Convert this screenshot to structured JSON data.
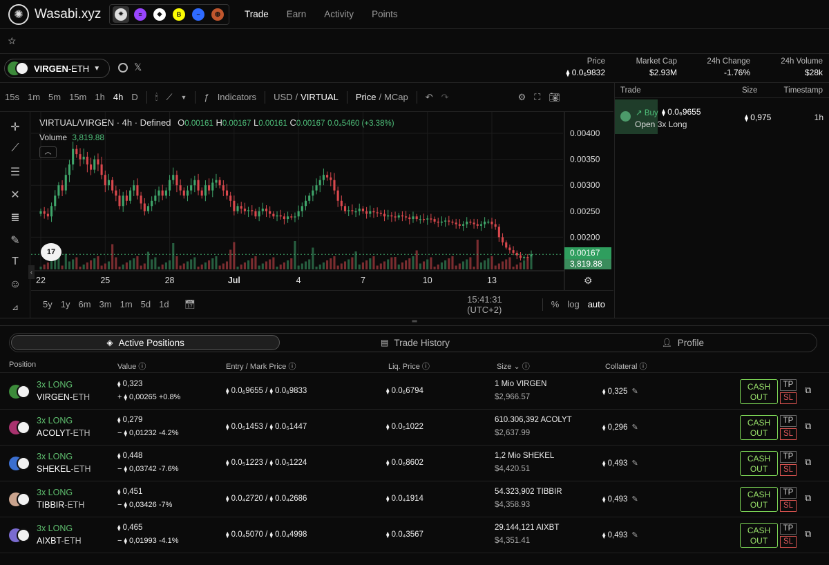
{
  "app": {
    "name": "Wasabi.xyz"
  },
  "nav": [
    "Trade",
    "Earn",
    "Activity",
    "Points"
  ],
  "chains": [
    {
      "icon": "wasabi-icon",
      "color": "#dddddd",
      "glyph": "✷"
    },
    {
      "icon": "solana-icon",
      "color": "#9945ff",
      "glyph": "≡"
    },
    {
      "icon": "ethereum-icon",
      "color": "#ffffff",
      "glyph": "◆"
    },
    {
      "icon": "blast-icon",
      "color": "#fcfc03",
      "glyph": "B"
    },
    {
      "icon": "base-icon",
      "color": "#2f6bff",
      "glyph": "−"
    },
    {
      "icon": "ape-icon",
      "color": "#c0562d",
      "glyph": "◍"
    }
  ],
  "favorites": {
    "star": "☆"
  },
  "pair": {
    "base": "VIRGEN",
    "quote": "-ETH"
  },
  "stats": {
    "price_label": "Price",
    "price_value": "0.0₆9832",
    "mcap_label": "Market Cap",
    "mcap_value": "$2.93M",
    "change_label": "24h Change",
    "change_value": "-1.76%",
    "volume_label": "24h Volume",
    "volume_value": "$28k"
  },
  "toolbar": {
    "intervals": [
      "15s",
      "1m",
      "5m",
      "15m",
      "1h",
      "4h",
      "D"
    ],
    "active": "4h",
    "indicators": "Indicators",
    "usd": "USD",
    "slash": "/",
    "virtual": "VIRTUAL",
    "price": "Price",
    "mcap": "MCap"
  },
  "chart_legend": {
    "symbol": "VIRTUAL/VIRGEN · 4h · Defined",
    "o_label": "O",
    "o": "0.00161",
    "h_label": "H",
    "h": "0.00167",
    "l_label": "L",
    "l": "0.00161",
    "c_label": "C",
    "c": "0.00167",
    "change": "0.0₄5460 (+3.38%)",
    "volume_label": "Volume",
    "volume_value": "3,819.88",
    "current_price_tag": "0.00167",
    "current_volume_tag": "3,819.88",
    "tv_logo": "17"
  },
  "chart_data": {
    "type": "candlestick",
    "y_ticks": [
      "0.00400",
      "0.00350",
      "0.00300",
      "0.00250",
      "0.00200"
    ],
    "y_tick_values": [
      0.004,
      0.0035,
      0.003,
      0.0025,
      0.002
    ],
    "ylim": [
      0.00138,
      0.00428
    ],
    "x_ticks": [
      "22",
      "25",
      "28",
      "Jul",
      "4",
      "7",
      "10",
      "13"
    ],
    "x_tick_index": [
      0,
      18,
      36,
      54,
      72,
      90,
      108,
      126
    ],
    "close": [
      0.0025,
      0.00245,
      0.0024,
      0.0026,
      0.0028,
      0.003,
      0.0029,
      0.0032,
      0.0034,
      0.0037,
      0.0036,
      0.0035,
      0.00355,
      0.0034,
      0.0033,
      0.0035,
      0.0034,
      0.0032,
      0.003,
      0.0031,
      0.0029,
      0.0028,
      0.0026,
      0.0028,
      0.0027,
      0.0029,
      0.003,
      0.0028,
      0.00265,
      0.0025,
      0.0026,
      0.0027,
      0.0028,
      0.0029,
      0.0028,
      0.0029,
      0.0031,
      0.0032,
      0.003,
      0.0029,
      0.0028,
      0.0029,
      0.003,
      0.0031,
      0.0029,
      0.0028,
      0.003,
      0.0029,
      0.00305,
      0.0031,
      0.003,
      0.0029,
      0.0028,
      0.0027,
      0.0025,
      0.0026,
      0.00255,
      0.0025,
      0.00252,
      0.0025,
      0.0024,
      0.0025,
      0.00255,
      0.0025,
      0.00245,
      0.0024,
      0.00242,
      0.0024,
      0.00235,
      0.0024,
      0.00238,
      0.0024,
      0.0025,
      0.0026,
      0.0027,
      0.0028,
      0.0029,
      0.003,
      0.0031,
      0.0032,
      0.00315,
      0.0031,
      0.0029,
      0.0027,
      0.0026,
      0.0025,
      0.00252,
      0.0025,
      0.0025,
      0.00255,
      0.0025,
      0.00245,
      0.0025,
      0.00248,
      0.00247,
      0.00245,
      0.0024,
      0.00242,
      0.0024,
      0.00238,
      0.00242,
      0.0024,
      0.00238,
      0.00235,
      0.0024,
      0.00235,
      0.00235,
      0.00234,
      0.00236,
      0.00235,
      0.0023,
      0.00228,
      0.0023,
      0.00232,
      0.0023,
      0.00228,
      0.00225,
      0.00222,
      0.00225,
      0.0023,
      0.00228,
      0.00225,
      0.00222,
      0.00225,
      0.0023,
      0.0023,
      0.00225,
      0.0022,
      0.002,
      0.0019,
      0.0018,
      0.00175,
      0.0017,
      0.00165,
      0.0016,
      0.00162,
      0.00161,
      0.00167
    ],
    "volume_max": 0.18
  },
  "chart_bottom": {
    "ranges": [
      "5y",
      "1y",
      "6m",
      "3m",
      "1m",
      "5d",
      "1d"
    ],
    "time": "15:41:31 (UTC+2)",
    "percent": "%",
    "log": "log",
    "auto": "auto"
  },
  "trades": {
    "head": {
      "trade": "Trade",
      "size": "Size",
      "timestamp": "Timestamp"
    },
    "rows": [
      {
        "side": "Buy",
        "price": "0.0₆9655",
        "desc": "Open 3x Long",
        "size": "0,975",
        "time": "1h"
      }
    ]
  },
  "tabs": [
    "Active Positions",
    "Trade History",
    "Profile"
  ],
  "positions_head": {
    "position": "Position",
    "value": "Value",
    "entry": "Entry / Mark Price",
    "liq": "Liq. Price",
    "size": "Size",
    "collateral": "Collateral"
  },
  "positions": [
    {
      "avatar": "#3c8a3a",
      "side": "3x LONG",
      "base": "VIRGEN",
      "quote": "-ETH",
      "value": "0,323",
      "pnl": "0,00265",
      "pnl_pct": "+0.8%",
      "pnl_sign": "+",
      "pnl_class": "pos",
      "entry": "0.0₆9655",
      "mark": "0.0₆9833",
      "liq": "0.0₆6794",
      "size": "1 Mio VIRGEN",
      "size_usd": "$2,966.57",
      "collateral": "0,325"
    },
    {
      "avatar": "#a8326e",
      "side": "3x LONG",
      "base": "ACOLYT",
      "quote": "-ETH",
      "value": "0,279",
      "pnl": "0,01232",
      "pnl_pct": "-4.2%",
      "pnl_sign": "−",
      "pnl_class": "neg",
      "entry": "0.0₅1453",
      "mark": "0.0₅1447",
      "liq": "0.0₅1022",
      "size": "610.306,392 ACOLYT",
      "size_usd": "$2,637.99",
      "collateral": "0,296"
    },
    {
      "avatar": "#3b6fd0",
      "side": "3x LONG",
      "base": "SHEKEL",
      "quote": "-ETH",
      "value": "0,448",
      "pnl": "0,03742",
      "pnl_pct": "-7.6%",
      "pnl_sign": "−",
      "pnl_class": "neg",
      "entry": "0.0₅1223",
      "mark": "0.0₅1224",
      "liq": "0.0₆8602",
      "size": "1,2 Mio SHEKEL",
      "size_usd": "$4,420.51",
      "collateral": "0,493"
    },
    {
      "avatar": "#c9a38d",
      "side": "3x LONG",
      "base": "TIBBIR",
      "quote": "-ETH",
      "value": "0,451",
      "pnl": "0,03426",
      "pnl_pct": "-7%",
      "pnl_sign": "−",
      "pnl_class": "neg",
      "entry": "0.0₄2720",
      "mark": "0.0₄2686",
      "liq": "0.0₄1914",
      "size": "54.323,902 TIBBIR",
      "size_usd": "$4,358.93",
      "collateral": "0,493"
    },
    {
      "avatar": "#7a6bd0",
      "side": "3x LONG",
      "base": "AIXBT",
      "quote": "-ETH",
      "value": "0,465",
      "pnl": "0,01993",
      "pnl_pct": "-4.1%",
      "pnl_sign": "−",
      "pnl_class": "neg",
      "entry": "0.0₄5070",
      "mark": "0.0₄4998",
      "liq": "0.0₄3567",
      "size": "29.144,121 AIXBT",
      "size_usd": "$4,351.41",
      "collateral": "0,493"
    }
  ],
  "actions": {
    "cash_line1": "CASH",
    "cash_line2": "OUT",
    "tp": "TP",
    "sl": "SL"
  },
  "symbols": {
    "eth": "⧫"
  }
}
